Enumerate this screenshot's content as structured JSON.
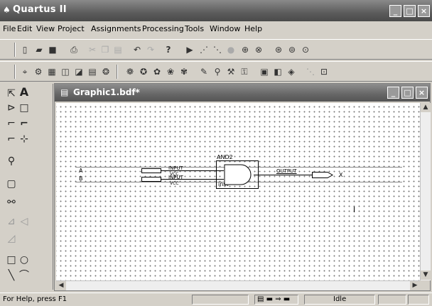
{
  "window": {
    "title": "Quartus II",
    "logo_glyph": "♠"
  },
  "menu": [
    "File",
    "Edit",
    "View",
    "Project",
    "Assignments",
    "Processing",
    "Tools",
    "Window",
    "Help"
  ],
  "toolbar1_icons": [
    "new-icon",
    "open-icon",
    "save-icon",
    "print-icon",
    "cut-icon",
    "copy-icon",
    "paste-icon",
    "undo-icon",
    "redo-icon",
    "whats-this-icon",
    "start-compilation-icon",
    "start-analysis-icon",
    "start-timing-icon",
    "stop-icon",
    "compiler-tool-icon",
    "simulator-tool-icon",
    "programmer-icon",
    "chip-planner-icon",
    "assignment-editor-icon"
  ],
  "toolbar2_icons": [
    "hierarchy-icon",
    "settings-icon",
    "device-icon",
    "pin-planner-icon",
    "timing-wizard-icon",
    "floorplan-icon",
    "compile-icon",
    "analyze-icon",
    "fit-icon",
    "assemble-icon",
    "timing-icon",
    "eda-icon",
    "pencil-icon",
    "wand-icon",
    "wrench-icon",
    "lock-icon",
    "report-icon",
    "rtl-viewer-icon",
    "tech-map-icon",
    "grid-icon",
    "zoom-fit-icon"
  ],
  "palette": [
    "selection-tool-icon",
    "text-tool-icon",
    "symbol-tool-icon",
    "block-tool-icon",
    "orthogonal-node-tool-icon",
    "orthogonal-bus-tool-icon",
    "conduit-tool-icon",
    "rubberband-icon",
    "zoom-tool-icon",
    "full-screen-icon",
    "find-icon",
    "flip-horizontal-icon",
    "flip-vertical-icon",
    "rotate-icon",
    "rectangle-tool-icon",
    "oval-tool-icon",
    "line-tool-icon",
    "arc-tool-icon"
  ],
  "child_window": {
    "title": "Graphic1.bdf*"
  },
  "schematic": {
    "input_a_name": "A",
    "input_b_name": "B",
    "input_a_label": "INPUT",
    "input_a_sub": "VCC",
    "input_b_label": "INPUT",
    "input_b_sub": "VCC",
    "gate_name": "AND2",
    "gate_instance": "inst",
    "output_label": "OUTPUT",
    "output_name": "X"
  },
  "status": {
    "help": "For Help, press F1",
    "state": "Idle"
  }
}
